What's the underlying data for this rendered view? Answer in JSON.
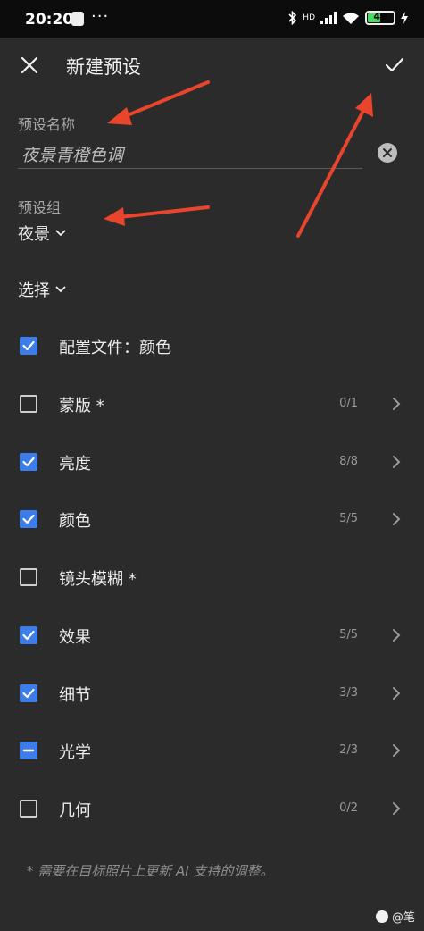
{
  "status_bar": {
    "time": "20:20",
    "dots": "···",
    "signal_text": "HD",
    "battery": "49"
  },
  "toolbar": {
    "title": "新建预设"
  },
  "preset_name": {
    "label": "预设名称",
    "value": "夜景青橙色调"
  },
  "preset_group": {
    "label": "预设组",
    "value": "夜景"
  },
  "select": {
    "label": "选择"
  },
  "items": [
    {
      "label": "配置文件：颜色",
      "state": "checked",
      "count": "",
      "chevron": false
    },
    {
      "label": "蒙版 *",
      "state": "unchecked",
      "count": "0/1",
      "chevron": true
    },
    {
      "label": "亮度",
      "state": "checked",
      "count": "8/8",
      "chevron": true
    },
    {
      "label": "颜色",
      "state": "checked",
      "count": "5/5",
      "chevron": true
    },
    {
      "label": "镜头模糊 *",
      "state": "unchecked",
      "count": "",
      "chevron": false
    },
    {
      "label": "效果",
      "state": "checked",
      "count": "5/5",
      "chevron": true
    },
    {
      "label": "细节",
      "state": "checked",
      "count": "3/3",
      "chevron": true
    },
    {
      "label": "光学",
      "state": "partial",
      "count": "2/3",
      "chevron": true
    },
    {
      "label": "几何",
      "state": "unchecked",
      "count": "0/2",
      "chevron": true
    }
  ],
  "footnote": "* 需要在目标照片上更新 AI 支持的调整。",
  "watermark": "@笔",
  "colors": {
    "accent": "#3d7dea",
    "background": "#2b2b2b",
    "annotation_arrow": "#e8452c"
  }
}
